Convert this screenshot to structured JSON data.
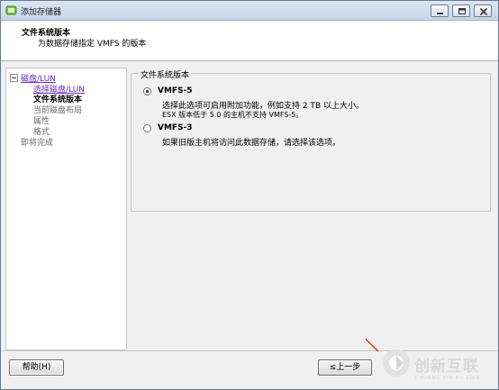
{
  "window": {
    "title": "添加存储器",
    "buttons": [
      "minimize",
      "maximize",
      "close"
    ]
  },
  "header": {
    "title": "文件系统版本",
    "subtitle": "为数据存储指定 VMFS 的版本"
  },
  "nav": {
    "items": [
      {
        "label": "磁盘/LUN",
        "state": "link"
      },
      {
        "label": "选择磁盘/LUN",
        "state": "link"
      },
      {
        "label": "文件系统版本",
        "state": "current"
      },
      {
        "label": "当前磁盘布局",
        "state": "disabled"
      },
      {
        "label": "属性",
        "state": "disabled"
      },
      {
        "label": "格式",
        "state": "disabled"
      },
      {
        "label": "即将完成",
        "state": "disabled"
      }
    ]
  },
  "group": {
    "legend": "文件系统版本",
    "options": [
      {
        "label": "VMFS-5",
        "selected": true,
        "desc1": "选择此选项可启用附加功能，例如支持 2 TB 以上大小。",
        "desc2": "ESX 版本低于 5.0 的主机不支持 VMFS-5。"
      },
      {
        "label": "VMFS-3",
        "selected": false,
        "desc1": "如果旧版主机将访问此数据存储，请选择该选项。"
      }
    ]
  },
  "footer": {
    "help_label": "帮助(H)",
    "back_label": "≤上一步"
  },
  "watermark": {
    "text": "创新互联",
    "sub": "CHUANG XIN HU LIAN"
  },
  "colors": {
    "link": "#6b2bbb",
    "titlebar": "#c5d6ea",
    "panel": "#f0f0f0"
  }
}
